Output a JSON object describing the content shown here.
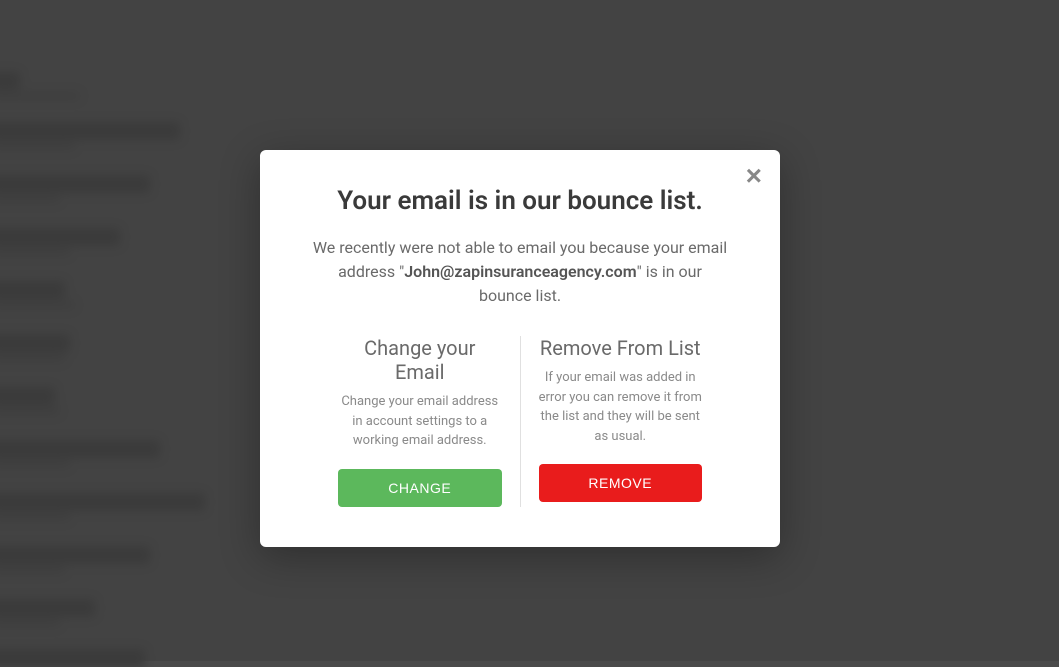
{
  "modal": {
    "title": "Your email is in our bounce list.",
    "description_pre": "We recently were not able to email you because your email address \"",
    "email": "John@zapinsuranceagency.com",
    "description_post": "\" is in our bounce list.",
    "close_label": "×",
    "options": {
      "change": {
        "title": "Change your Email",
        "description": "Change your email address in account settings to a working email address.",
        "button": "CHANGE"
      },
      "remove": {
        "title": "Remove From List",
        "description": "If your email was added in error you can remove it from the list and they will be sent as usual.",
        "button": "REMOVE"
      }
    }
  }
}
